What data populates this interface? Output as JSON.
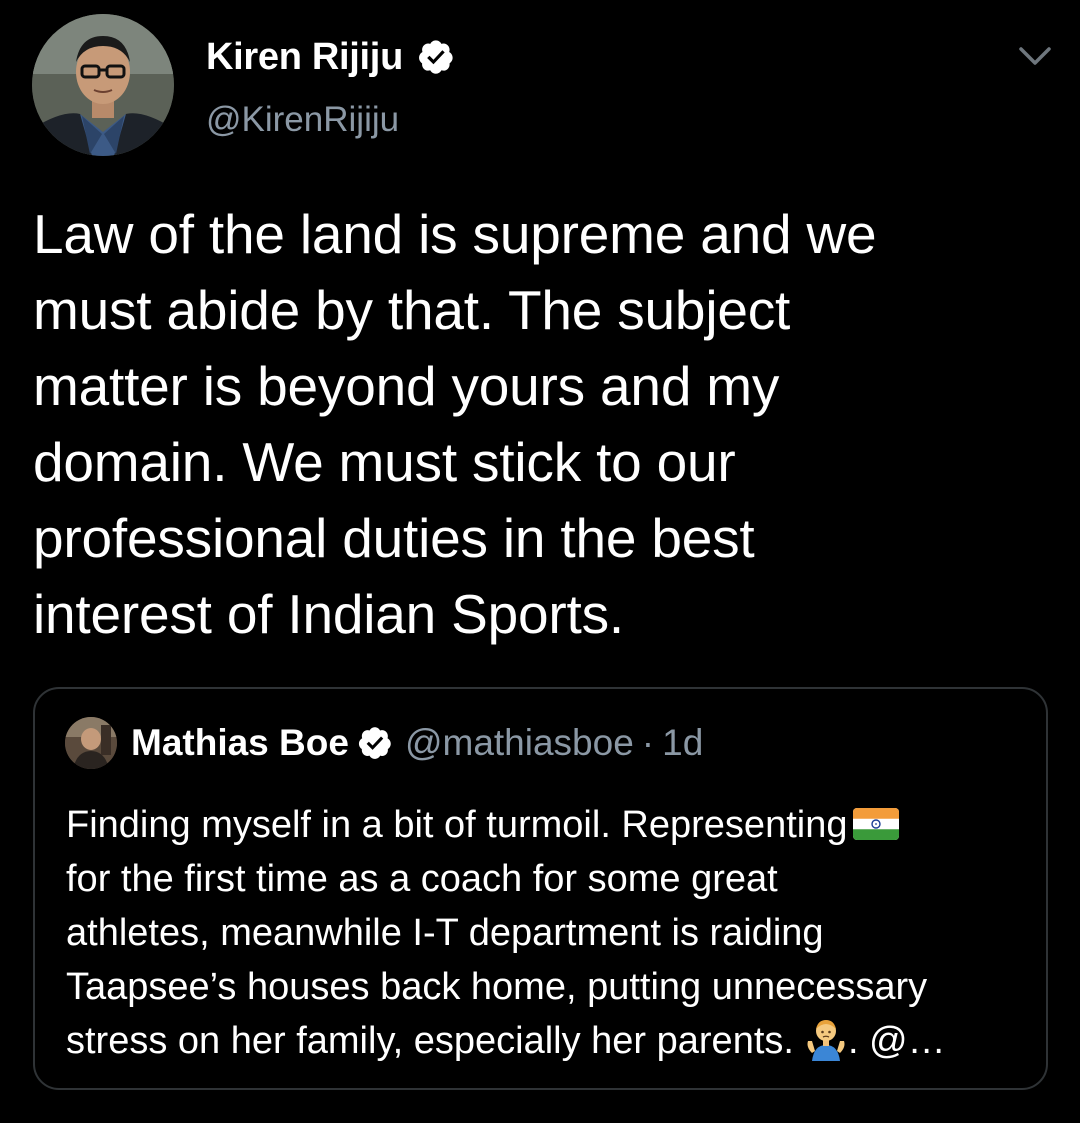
{
  "author": {
    "name": "Kiren Rijiju",
    "handle": "@KirenRijiju",
    "verified_icon": "verified-badge-icon"
  },
  "menu_icon": "chevron-down-icon",
  "tweet": {
    "lines": [
      "Law of the land is supreme and we",
      "must abide by that. The subject",
      "matter is beyond yours and my",
      "domain. We must stick to our",
      "professional duties in the best",
      "interest of Indian Sports."
    ]
  },
  "quoted": {
    "name": "Mathias Boe",
    "handle": "@mathiasboe",
    "separator": "·",
    "time": "1d",
    "lines": [
      "Finding myself in a bit of turmoil.  Representing",
      "for the first time as a coach for some great",
      "athletes,  meanwhile I-T department is raiding",
      "Taapsee’s houses back home, putting unnecessary",
      "stress on her family, especially her parents."
    ],
    "tail": ". @…",
    "emoji": [
      "india-flag-emoji",
      "person-shrugging-emoji"
    ]
  },
  "colors": {
    "background": "#000000",
    "text": "#ffffff",
    "secondary": "#8b98a5",
    "border": "#2f3336",
    "verified_badge": "#ffffff"
  }
}
